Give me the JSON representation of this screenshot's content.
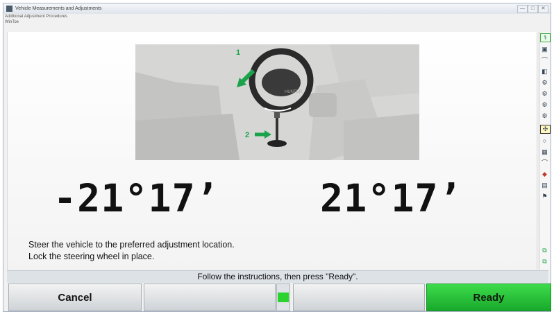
{
  "window": {
    "title": "Vehicle Measurements and Adjustments",
    "menu": "Additional Adjustment Procedures",
    "submenu": "WinToe",
    "controls": [
      "—",
      "□",
      "✕"
    ]
  },
  "readings": {
    "left": "-21°17’",
    "right": "21°17’"
  },
  "illustration": {
    "step1": "1",
    "step2": "2",
    "wheel_logo": "HUNTER"
  },
  "instructions": {
    "line1": "Steer the vehicle to the preferred adjustment location.",
    "line2": "Lock the steering wheel in place."
  },
  "status": "Follow the instructions, then press \"Ready\".",
  "buttons": {
    "cancel": "Cancel",
    "blank1": "",
    "blank2": "",
    "ready": "Ready"
  },
  "colors": {
    "ready": "#22b833",
    "status_bar": "#dde2e6",
    "arrow_green": "#1aa34a"
  },
  "rightbar_icons": [
    "help-icon",
    "vehicle-icon",
    "arc-icon",
    "tire-icon",
    "caster-icon",
    "camber-icon",
    "toe-icon",
    "steer-icon",
    "alignment-icon",
    "wheel-icon",
    "tire2-icon",
    "arc2-icon",
    "car-icon",
    "print-icon",
    "flag-icon",
    "tool-icon"
  ]
}
